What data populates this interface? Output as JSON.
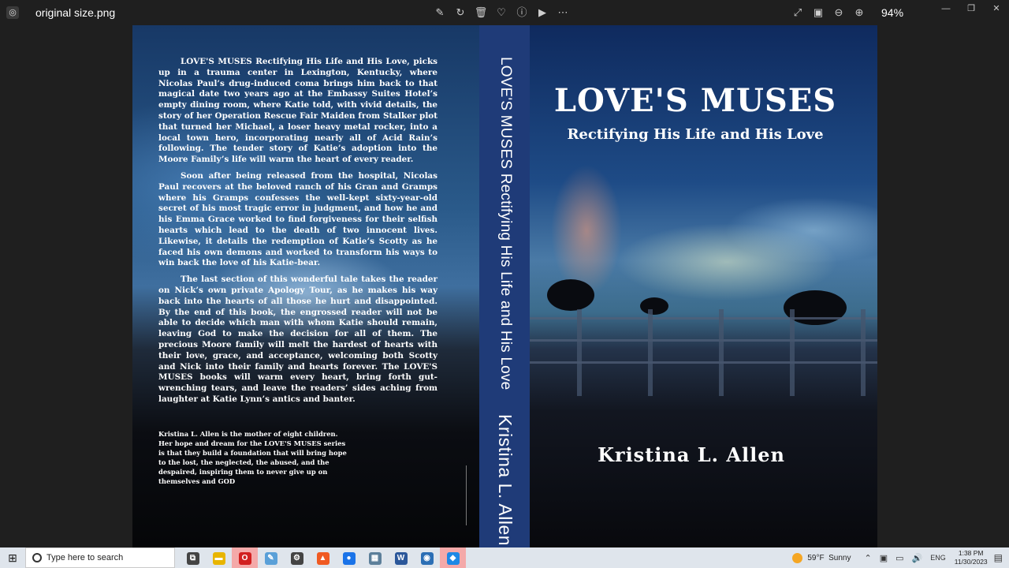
{
  "window": {
    "filename": "original size.png",
    "zoom": "94%",
    "toolbar_icons": [
      "edit-icon",
      "rotate-icon",
      "delete-icon",
      "favorite-icon",
      "info-icon",
      "slideshow-icon",
      "more-icon"
    ],
    "right_icons": [
      "fullscreen-icon",
      "actual-size-icon",
      "zoom-out-icon",
      "zoom-in-icon"
    ],
    "controls": [
      "minimize",
      "maximize",
      "close"
    ]
  },
  "book": {
    "back_paragraphs": [
      "LOVE'S MUSES Rectifying His Life and His Love, picks up in a trauma center in Lexington, Kentucky, where Nicolas Paul’s drug-induced coma brings him back to that magical date two years ago at the Embassy Suites Hotel’s empty dining room, where Katie told, with vivid details, the story of her Operation Rescue Fair Maiden from Stalker plot that turned her Michael, a loser heavy metal rocker, into a local town hero, incorporating nearly all of Acid Rain’s following. The tender story of Katie’s adoption into the Moore Family’s life will warm the heart of every reader.",
      "Soon after being released from the hospital, Nicolas Paul recovers at the beloved ranch of his Gran and Gramps where his Gramps confesses the well-kept sixty-year-old secret of his most tragic error in judgment, and how he and his Emma Grace worked to find forgiveness for their selfish hearts which lead to the death of two innocent lives. Likewise, it details the redemption of Katie’s Scotty as he faced his own demons and worked to transform his ways to win back the love of his Katie-bear.",
      "The last section of this wonderful tale takes the reader on Nick’s own private Apology Tour, as he makes his way back into the hearts of all those he hurt and disappointed. By the end of this book, the engrossed reader will not be able to decide which man with whom Katie should remain, leaving God to make the decision for all of them. The precious Moore family will melt the hardest of hearts with their love, grace, and acceptance, welcoming both Scotty and Nick into their family and hearts forever.    The LOVE'S MUSES books will warm every heart, bring forth gut-wrenching tears, and leave the readers’ sides aching from laughter at Katie Lynn’s antics and banter."
    ],
    "bio": "Kristina L. Allen is the mother of eight children. Her hope and dream for the LOVE'S MUSES series is that they build a foundation that will bring hope to the lost, the neglected, the abused, and the despaired, inspiring them to never give up on themselves and GOD",
    "spine_title": "LOVE'S MUSES Rectifying His Life and His Love",
    "spine_author": "Kristina L. Allen",
    "front_title": "LOVE'S  MUSES",
    "front_subtitle": "Rectifying His Life and His Love",
    "front_author": "Kristina  L.  Allen"
  },
  "taskbar": {
    "search_placeholder": "Type here to search",
    "apps": [
      {
        "icon": "task-view-icon",
        "glyph": "⧉",
        "color": "#444444"
      },
      {
        "icon": "file-explorer-icon",
        "glyph": "▬",
        "color": "#e8b500"
      },
      {
        "icon": "opera-icon",
        "glyph": "O",
        "color": "#d21f1f"
      },
      {
        "icon": "notepad-icon",
        "glyph": "✎",
        "color": "#5aa0d8"
      },
      {
        "icon": "settings-icon",
        "glyph": "⚙",
        "color": "#444444"
      },
      {
        "icon": "brave-icon",
        "glyph": "▲",
        "color": "#f05a22"
      },
      {
        "icon": "chrome-icon",
        "glyph": "●",
        "color": "#1a73e8"
      },
      {
        "icon": "photos-icon",
        "glyph": "▦",
        "color": "#5c7f9a"
      },
      {
        "icon": "word-icon",
        "glyph": "W",
        "color": "#2b579a"
      },
      {
        "icon": "camera-icon",
        "glyph": "◉",
        "color": "#2c6fb5"
      },
      {
        "icon": "photos-app-icon",
        "glyph": "◆",
        "color": "#1e88e5"
      }
    ],
    "weather_temp": "59°F",
    "weather_desc": "Sunny",
    "language": "ENG",
    "time": "1:38 PM",
    "date": "11/30/2023"
  }
}
